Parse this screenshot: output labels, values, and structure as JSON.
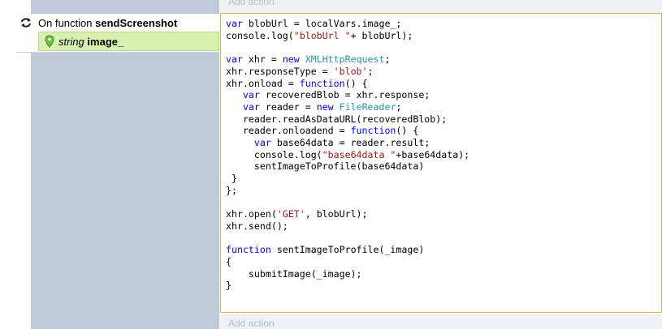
{
  "event": {
    "prefix": "On function",
    "function_name": "sendScreenshot"
  },
  "parameter": {
    "type": "string",
    "name": "image_"
  },
  "add_action_label": "Add action",
  "code_lines": [
    [
      {
        "t": "var",
        "c": "kw"
      },
      {
        "t": " blobUrl = localVars.image_;"
      }
    ],
    [
      {
        "t": "console.log("
      },
      {
        "t": "\"blobUrl \"",
        "c": "str"
      },
      {
        "t": "+ blobUrl);"
      }
    ],
    [
      {
        "t": ""
      }
    ],
    [
      {
        "t": "var",
        "c": "kw"
      },
      {
        "t": " xhr = "
      },
      {
        "t": "new",
        "c": "kw"
      },
      {
        "t": " "
      },
      {
        "t": "XMLHttpRequest",
        "c": "cls"
      },
      {
        "t": ";"
      }
    ],
    [
      {
        "t": "xhr.responseType = "
      },
      {
        "t": "'blob'",
        "c": "str"
      },
      {
        "t": ";"
      }
    ],
    [
      {
        "t": "xhr.onload = "
      },
      {
        "t": "function",
        "c": "kw"
      },
      {
        "t": "() {"
      }
    ],
    [
      {
        "t": "   "
      },
      {
        "t": "var",
        "c": "kw"
      },
      {
        "t": " recoveredBlob = xhr.response;"
      }
    ],
    [
      {
        "t": "   "
      },
      {
        "t": "var",
        "c": "kw"
      },
      {
        "t": " reader = "
      },
      {
        "t": "new",
        "c": "kw"
      },
      {
        "t": " "
      },
      {
        "t": "FileReader",
        "c": "cls"
      },
      {
        "t": ";"
      }
    ],
    [
      {
        "t": "   reader.readAsDataURL(recoveredBlob);"
      }
    ],
    [
      {
        "t": "   reader.onloadend = "
      },
      {
        "t": "function",
        "c": "kw"
      },
      {
        "t": "() {"
      }
    ],
    [
      {
        "t": "     "
      },
      {
        "t": "var",
        "c": "kw"
      },
      {
        "t": " base64data = reader.result;"
      }
    ],
    [
      {
        "t": "     console.log("
      },
      {
        "t": "\"base64data \"",
        "c": "str"
      },
      {
        "t": "+base64data);"
      }
    ],
    [
      {
        "t": "     sentImageToProfile(base64data)"
      }
    ],
    [
      {
        "t": " }"
      }
    ],
    [
      {
        "t": "};"
      }
    ],
    [
      {
        "t": ""
      }
    ],
    [
      {
        "t": "xhr.open("
      },
      {
        "t": "'GET'",
        "c": "str"
      },
      {
        "t": ", blobUrl);"
      }
    ],
    [
      {
        "t": "xhr.send();"
      }
    ],
    [
      {
        "t": ""
      }
    ],
    [
      {
        "t": "function",
        "c": "kw"
      },
      {
        "t": " sentImageToProfile(_image)"
      }
    ],
    [
      {
        "t": "{"
      }
    ],
    [
      {
        "t": "    submitImage(_image);"
      }
    ],
    [
      {
        "t": "}"
      }
    ]
  ],
  "colors": {
    "keyword": "#0000ff",
    "class": "#2b91af",
    "string": "#a31515",
    "param_bg": "#d8f0b0",
    "code_border": "#e2b04a",
    "sidebar": "#bfcad9"
  },
  "icons": {
    "event": "loop-arrows-icon",
    "parameter": "map-pin-icon"
  }
}
